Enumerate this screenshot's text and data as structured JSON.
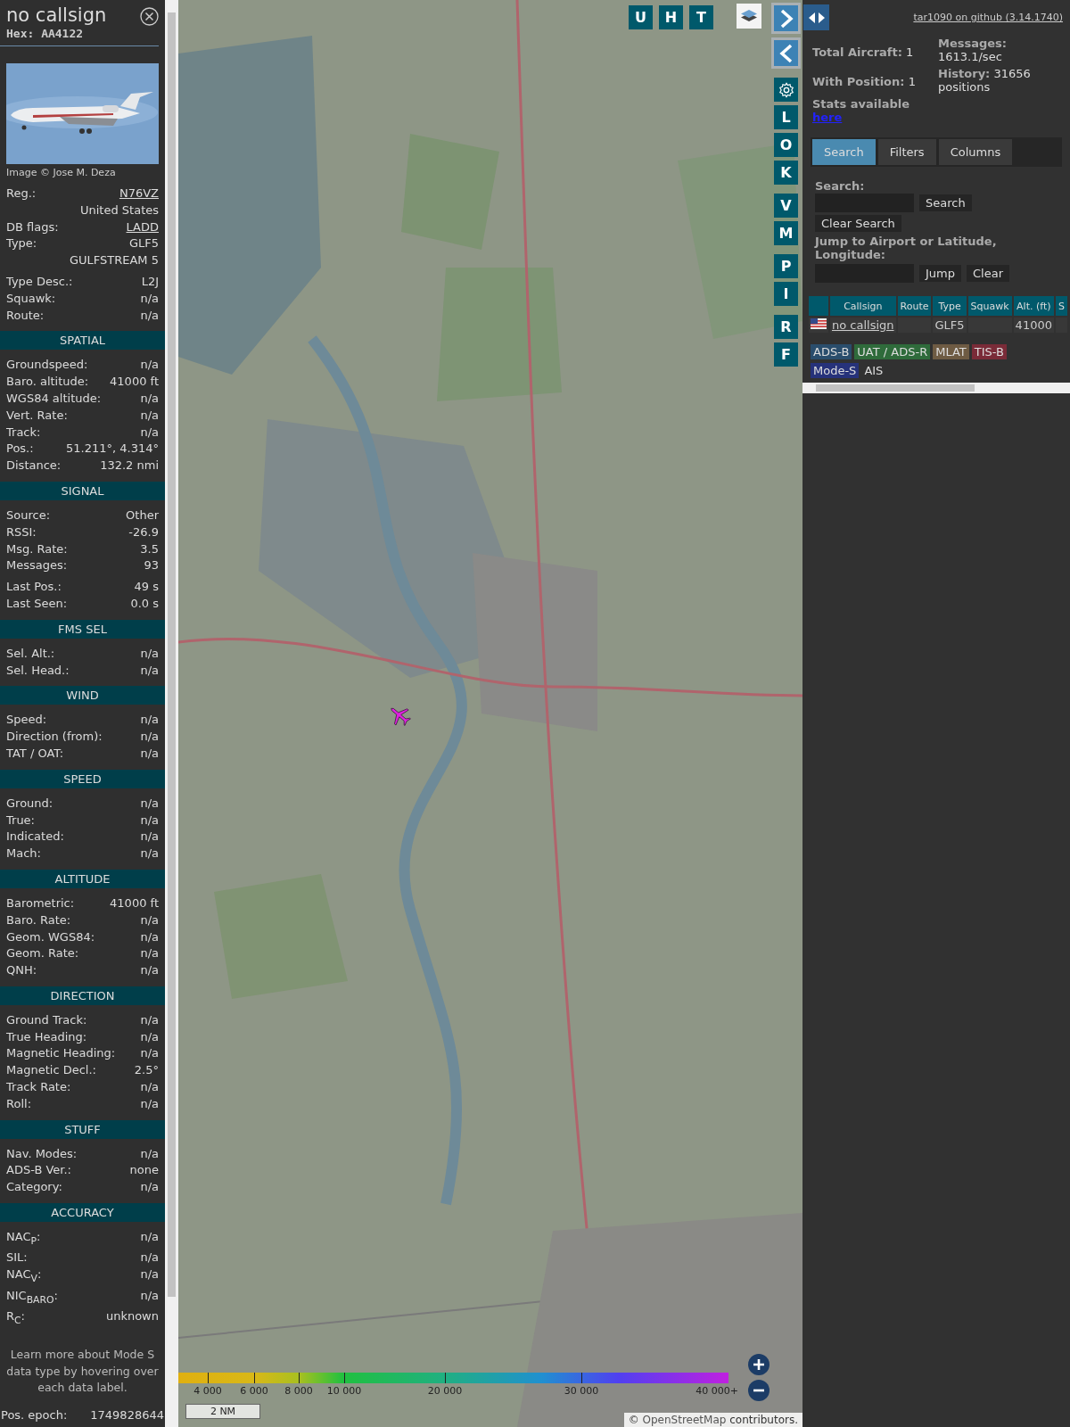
{
  "detail_panel": {
    "callsign": "no callsign",
    "hex": "Hex: AA4122",
    "photo": {
      "kind": "picture"
    },
    "photo_credit": "Image © Jose M. Deza",
    "info_groups": [
      [
        {
          "label": "Reg.:",
          "value": "N76VZ",
          "kind": "link"
        },
        {
          "value": "United States",
          "kind": "value_only"
        },
        {
          "label": "DB flags:",
          "value": "LADD",
          "kind": "link"
        },
        {
          "label": "Type:",
          "value": "GLF5",
          "kind": "plain"
        },
        {
          "value": "GULFSTREAM 5",
          "kind": "value_only"
        }
      ],
      [
        {
          "label": "Type Desc.:",
          "value": "L2J",
          "kind": "plain"
        },
        {
          "label": "Squawk:",
          "value": "n/a",
          "kind": "plain"
        },
        {
          "label": "Route:",
          "value": "n/a",
          "kind": "plain"
        }
      ]
    ],
    "sections": [
      {
        "title": "SPATIAL",
        "groups": [
          [
            {
              "label": "Groundspeed:",
              "value": "n/a",
              "kind": "plain"
            },
            {
              "label": "Baro. altitude:",
              "value": "41000 ft",
              "kind": "plain"
            },
            {
              "label": "WGS84 altitude:",
              "value": "n/a",
              "kind": "plain"
            },
            {
              "label": "Vert. Rate:",
              "value": "n/a",
              "kind": "plain"
            },
            {
              "label": "Track:",
              "value": "n/a",
              "kind": "plain"
            },
            {
              "label": "Pos.:",
              "value": "51.211°, 4.314°",
              "kind": "plain"
            },
            {
              "label": "Distance:",
              "value": "132.2 nmi",
              "kind": "plain"
            }
          ]
        ]
      },
      {
        "title": "SIGNAL",
        "groups": [
          [
            {
              "label": "Source:",
              "value": "Other",
              "kind": "plain"
            },
            {
              "label": "RSSI:",
              "value": "-26.9",
              "kind": "plain"
            },
            {
              "label": "Msg. Rate:",
              "value": "3.5",
              "kind": "plain"
            },
            {
              "label": "Messages:",
              "value": "93",
              "kind": "plain"
            }
          ],
          [
            {
              "label": "Last Pos.:",
              "value": "49 s",
              "kind": "plain"
            },
            {
              "label": "Last Seen:",
              "value": "0.0 s",
              "kind": "plain"
            }
          ]
        ]
      },
      {
        "title": "FMS SEL",
        "groups": [
          [
            {
              "label": "Sel. Alt.:",
              "value": "n/a",
              "kind": "plain"
            },
            {
              "label": "Sel. Head.:",
              "value": "n/a",
              "kind": "plain"
            }
          ]
        ]
      },
      {
        "title": "WIND",
        "groups": [
          [
            {
              "label": "Speed:",
              "value": "n/a",
              "kind": "plain"
            },
            {
              "label": "Direction (from):",
              "value": "n/a",
              "kind": "plain"
            },
            {
              "label": "TAT / OAT:",
              "value": "n/a",
              "kind": "plain"
            }
          ]
        ]
      },
      {
        "title": "SPEED",
        "groups": [
          [
            {
              "label": "Ground:",
              "value": "n/a",
              "kind": "plain"
            },
            {
              "label": "True:",
              "value": "n/a",
              "kind": "plain"
            },
            {
              "label": "Indicated:",
              "value": "n/a",
              "kind": "plain"
            },
            {
              "label": "Mach:",
              "value": "n/a",
              "kind": "plain"
            }
          ]
        ]
      },
      {
        "title": "ALTITUDE",
        "groups": [
          [
            {
              "label": "Barometric:",
              "value": "41000 ft",
              "kind": "plain"
            },
            {
              "label": "Baro. Rate:",
              "value": "n/a",
              "kind": "plain"
            },
            {
              "label": "Geom. WGS84:",
              "value": "n/a",
              "kind": "plain"
            },
            {
              "label": "Geom. Rate:",
              "value": "n/a",
              "kind": "plain"
            },
            {
              "label": "QNH:",
              "value": "n/a",
              "kind": "plain"
            }
          ]
        ]
      },
      {
        "title": "DIRECTION",
        "groups": [
          [
            {
              "label": "Ground Track:",
              "value": "n/a",
              "kind": "plain"
            },
            {
              "label": "True Heading:",
              "value": "n/a",
              "kind": "plain"
            },
            {
              "label": "Magnetic Heading:",
              "value": "n/a",
              "kind": "plain"
            },
            {
              "label": "Magnetic Decl.:",
              "value": "2.5°",
              "kind": "plain"
            },
            {
              "label": "Track Rate:",
              "value": "n/a",
              "kind": "plain"
            },
            {
              "label": "Roll:",
              "value": "n/a",
              "kind": "plain"
            }
          ]
        ]
      },
      {
        "title": "STUFF",
        "groups": [
          [
            {
              "label": "Nav. Modes:",
              "value": "n/a",
              "kind": "plain"
            },
            {
              "label": "ADS-B Ver.:",
              "value": "none",
              "kind": "plain"
            },
            {
              "label": "Category:",
              "value": "n/a",
              "kind": "plain"
            }
          ]
        ]
      },
      {
        "title": "ACCURACY",
        "groups": [
          [
            {
              "label": "NAC$_{P}$:",
              "value": "n/a",
              "kind": "plain"
            },
            {
              "label": "SIL:",
              "value": "n/a",
              "kind": "plain"
            },
            {
              "label": "NAC$_{V}$:",
              "value": "n/a",
              "kind": "plain"
            },
            {
              "label": "NIC$_{BARO}$:",
              "value": "n/a",
              "kind": "plain"
            },
            {
              "label": "R$_{C}$:",
              "value": "unknown",
              "kind": "plain"
            }
          ]
        ]
      }
    ],
    "note": "Learn more about Mode S data type by hovering over each data label.",
    "footer_row": {
      "label": "Pos. epoch:",
      "value": "1749828644"
    }
  },
  "map": {
    "kind": "picture",
    "top_buttons": [
      "U",
      "H",
      "T"
    ],
    "side_button_groups": [
      [
        {
          "kind": "next"
        },
        {
          "kind": "prev"
        }
      ],
      [
        {
          "kind": "settings"
        },
        {
          "kind": "letter",
          "label": "L"
        },
        {
          "kind": "letter",
          "label": "O"
        },
        {
          "kind": "letter",
          "label": "K"
        }
      ],
      [
        {
          "kind": "letter",
          "label": "V"
        },
        {
          "kind": "letter",
          "label": "M"
        }
      ],
      [
        {
          "kind": "letter",
          "label": "P"
        },
        {
          "kind": "letter",
          "label": "I"
        }
      ],
      [
        {
          "kind": "letter",
          "label": "R"
        },
        {
          "kind": "letter",
          "label": "F"
        }
      ]
    ],
    "altitude_scale": [
      "4 000",
      "6 000",
      "8 000",
      "10 000",
      "20 000",
      "30 000",
      "40 000+"
    ],
    "scale_bar": "2 NM",
    "attribution": {
      "before": "©",
      "link": "OpenStreetMap",
      "after": "contributors."
    }
  },
  "sidebar": {
    "version_link": "tar1090 on github (3.14.1740)",
    "stats_left": [
      {
        "label": "Total Aircraft:",
        "value": "1"
      },
      {
        "label": "With Position:",
        "value": "1"
      }
    ],
    "stats_link": {
      "label": "Stats available",
      "link": "here"
    },
    "stats_right": [
      {
        "label": "Messages:",
        "value": "1613.1/sec"
      },
      {
        "label": "History:",
        "value": "31656 positions"
      }
    ],
    "tabs": [
      {
        "label": "Search",
        "selected": true
      },
      {
        "label": "Filters",
        "selected": false
      },
      {
        "label": "Columns",
        "selected": false
      }
    ],
    "search": {
      "label": "Search:",
      "button": "Search",
      "clear_button": "Clear Search"
    },
    "jump": {
      "label": "Jump to Airport or Latitude, Longitude:",
      "button": "Jump",
      "clear_button": "Clear"
    },
    "table": {
      "columns": [
        {
          "kind": "flag"
        },
        {
          "kind": "text",
          "label": "Callsign"
        },
        {
          "kind": "text",
          "label": "Route"
        },
        {
          "kind": "text",
          "label": "Type"
        },
        {
          "kind": "text",
          "label": "Squawk"
        },
        {
          "kind": "text",
          "label": "Alt. (ft)"
        },
        {
          "kind": "text",
          "label": "S"
        }
      ],
      "rows": [
        {
          "cells": [
            {
              "kind": "flag"
            },
            {
              "kind": "link",
              "text": "no callsign"
            },
            {
              "kind": "empty"
            },
            {
              "kind": "text",
              "text": "GLF5"
            },
            {
              "kind": "empty"
            },
            {
              "kind": "number",
              "text": "41000"
            },
            {
              "kind": "empty"
            }
          ]
        }
      ]
    },
    "legend": [
      {
        "label": "ADS-B",
        "color": "#2a4d6c"
      },
      {
        "label": "UAT / ADS-R",
        "color": "#2f6b3b"
      },
      {
        "label": "MLAT",
        "color": "#6e5b43"
      },
      {
        "label": "TIS-B",
        "color": "#7a2b38"
      },
      {
        "label": "Mode-S",
        "color": "#26327a"
      },
      {
        "label": "AIS"
      }
    ]
  }
}
